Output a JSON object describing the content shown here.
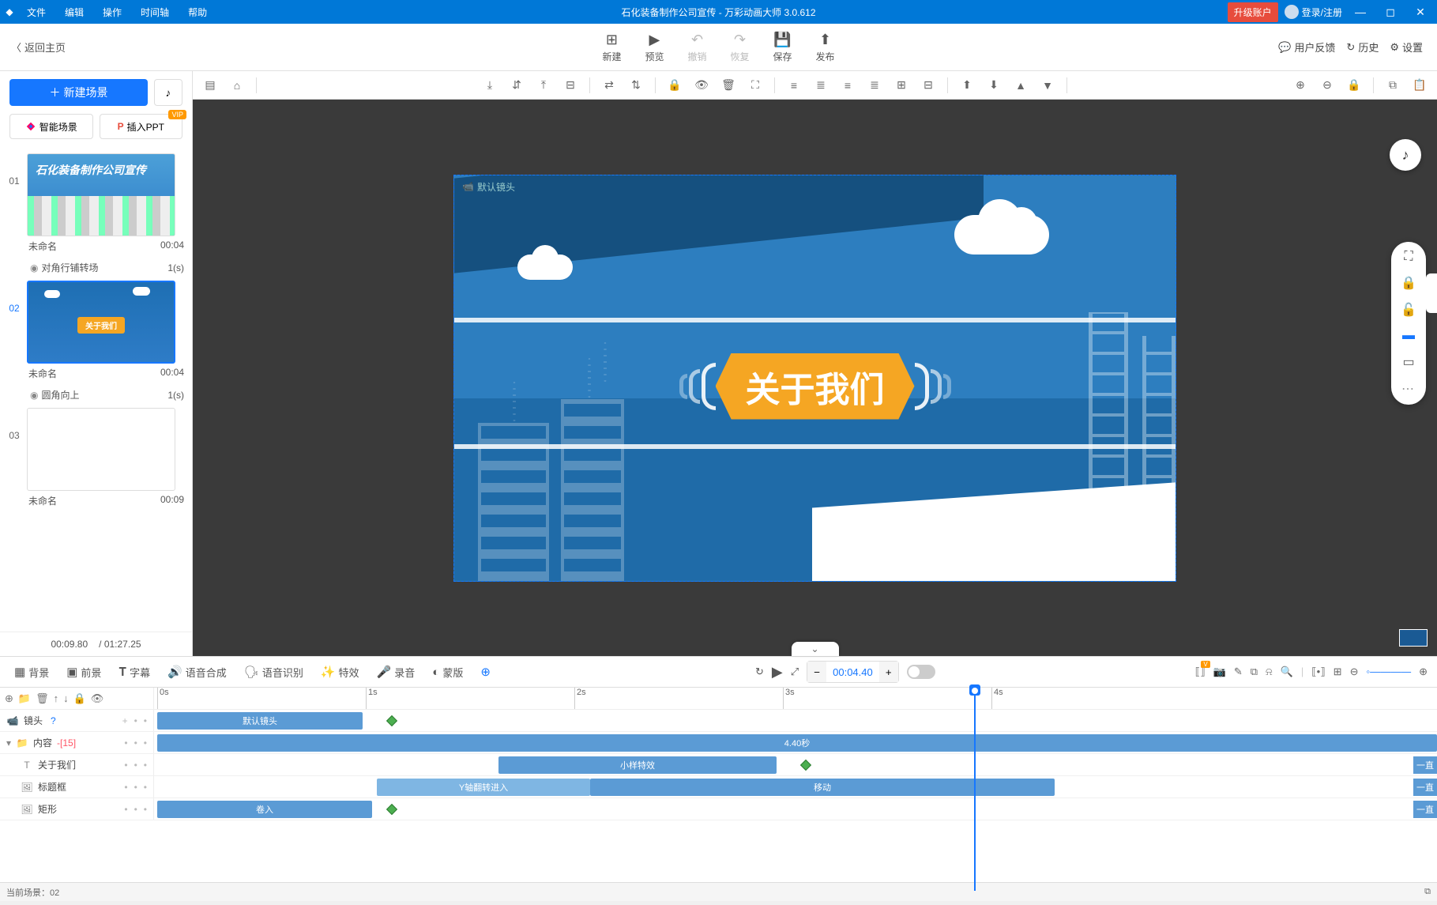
{
  "titlebar": {
    "menus": [
      "文件",
      "编辑",
      "操作",
      "时间轴",
      "帮助"
    ],
    "title": "石化装备制作公司宣传 - 万彩动画大师 3.0.612",
    "upgrade": "升级账户",
    "login": "登录/注册"
  },
  "secondbar": {
    "back": "返回主页",
    "actions": {
      "new": "新建",
      "preview": "预览",
      "undo": "撤销",
      "redo": "恢复",
      "save": "保存",
      "publish": "发布"
    },
    "right": {
      "feedback": "用户反馈",
      "history": "历史",
      "settings": "设置"
    }
  },
  "leftpanel": {
    "newscene": "新建场景",
    "ai_scene": "智能场景",
    "insert_ppt": "插入PPT",
    "vip": "VIP",
    "scenes": [
      {
        "num": "01",
        "name": "未命名",
        "duration": "00:04",
        "thumbtitle": "石化装备制作公司宣传"
      },
      {
        "num": "02",
        "name": "未命名",
        "duration": "00:04",
        "badgetext": "关于我们"
      },
      {
        "num": "03",
        "name": "未命名",
        "duration": "00:09"
      }
    ],
    "transitions": [
      {
        "name": "对角行铺转场",
        "dur": "1(s)"
      },
      {
        "name": "圆角向上",
        "dur": "1(s)"
      }
    ],
    "current_time": "00:09.80",
    "total_time": "/ 01:27.25"
  },
  "canvas": {
    "cam_label": "默认镜头",
    "badge_text": "关于我们"
  },
  "timeline_toolbar": {
    "tabs": {
      "bg": "背景",
      "fg": "前景",
      "subtitle": "字幕",
      "tts": "语音合成",
      "asr": "语音识别",
      "fx": "特效",
      "record": "录音",
      "mask": "蒙版"
    },
    "current_time": "00:04.40"
  },
  "timeline": {
    "ticks": [
      "0s",
      "1s",
      "2s",
      "3s",
      "4s"
    ],
    "tracks": {
      "camera": {
        "label": "镜头",
        "clip": "默认镜头"
      },
      "content": {
        "label": "内容",
        "count": "-[15]",
        "clip": "4.40秒"
      },
      "about": {
        "label": "关于我们",
        "clip": "小样特效",
        "end": "一直"
      },
      "titlebox": {
        "label": "标题框",
        "clip1": "Y轴翻转进入",
        "clip2": "移动",
        "end": "一直"
      },
      "rect": {
        "label": "矩形",
        "clip": "卷入",
        "end": "一直"
      }
    }
  },
  "statusbar": {
    "current_scene": "当前场景：02"
  }
}
